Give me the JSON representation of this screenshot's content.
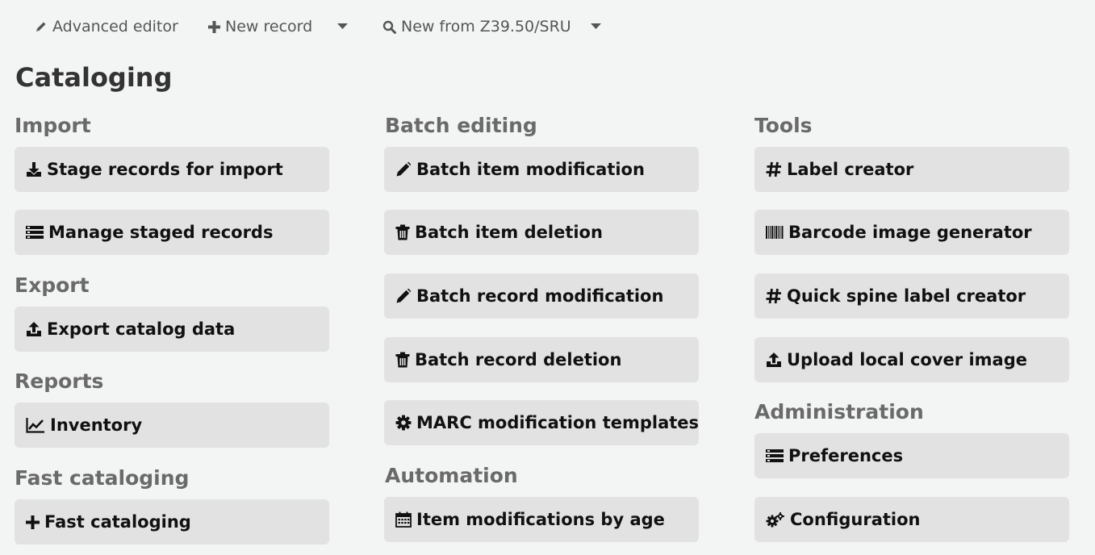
{
  "toolbar": {
    "advanced_editor": "Advanced editor",
    "new_record": "New record",
    "new_from_z3950": "New from Z39.50/SRU"
  },
  "page_title": "Cataloging",
  "sections": {
    "import": {
      "title": "Import",
      "items": [
        "Stage records for import",
        "Manage staged records"
      ]
    },
    "export": {
      "title": "Export",
      "items": [
        "Export catalog data"
      ]
    },
    "reports": {
      "title": "Reports",
      "items": [
        "Inventory"
      ]
    },
    "fast_cataloging": {
      "title": "Fast cataloging",
      "items": [
        "Fast cataloging"
      ]
    },
    "batch_editing": {
      "title": "Batch editing",
      "items": [
        "Batch item modification",
        "Batch item deletion",
        "Batch record modification",
        "Batch record deletion",
        "MARC modification templates"
      ]
    },
    "automation": {
      "title": "Automation",
      "items": [
        "Item modifications by age"
      ]
    },
    "tools": {
      "title": "Tools",
      "items": [
        "Label creator",
        "Barcode image generator",
        "Quick spine label creator",
        "Upload local cover image"
      ]
    },
    "administration": {
      "title": "Administration",
      "items": [
        "Preferences",
        "Configuration"
      ]
    }
  },
  "icons": {
    "stage_records": "download-icon",
    "manage_staged": "list-icon",
    "export_catalog": "upload-icon",
    "inventory": "line-chart-icon",
    "fast_cataloging": "plus-icon",
    "batch_item_modification": "pencil-icon",
    "batch_item_deletion": "trash-icon",
    "batch_record_modification": "pencil-icon",
    "batch_record_deletion": "trash-icon",
    "marc_templates": "gear-icon",
    "item_mod_by_age": "calendar-icon",
    "label_creator": "hashtag-icon",
    "barcode_generator": "barcode-icon",
    "quick_spine": "hashtag-icon",
    "upload_cover": "upload-icon",
    "preferences": "list-icon",
    "configuration": "gears-icon"
  },
  "colors": {
    "background": "#f3f4f4",
    "button_bg": "#e2e2e2",
    "section_title": "#6a6a6a",
    "toolbar_text": "#555555"
  }
}
